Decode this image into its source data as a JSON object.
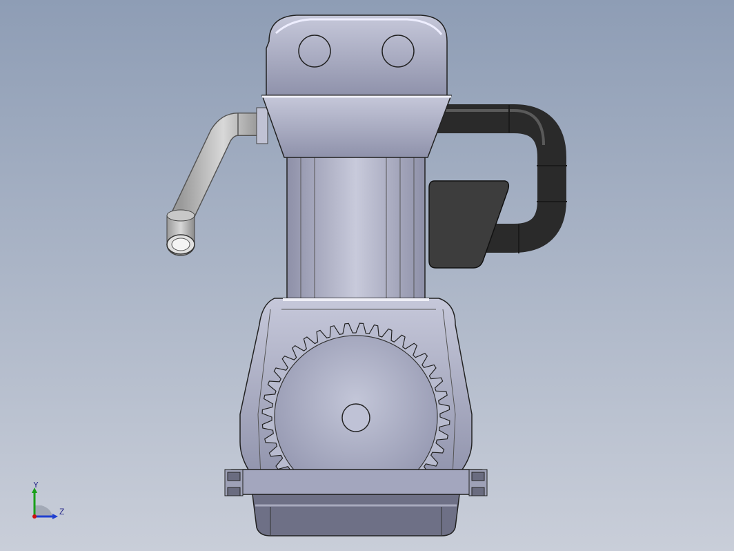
{
  "viewport": {
    "colors": {
      "bg_top": "#8e9db5",
      "bg_bottom": "#c9ced9"
    }
  },
  "model": {
    "parts": [
      "cylinder-head",
      "head-gasket-collar",
      "cylinder-barrel",
      "intake-pipe",
      "exhaust-pipe",
      "carburetor-block",
      "crankcase",
      "flywheel-gear",
      "crankshaft-hub",
      "oil-pan",
      "mounting-lug-left",
      "mounting-lug-right"
    ]
  },
  "triad": {
    "y_label": "Y",
    "z_label": "Z",
    "colors": {
      "y_axis": "#1aa01a",
      "z_axis": "#2040d0",
      "origin": "#d01010"
    }
  }
}
